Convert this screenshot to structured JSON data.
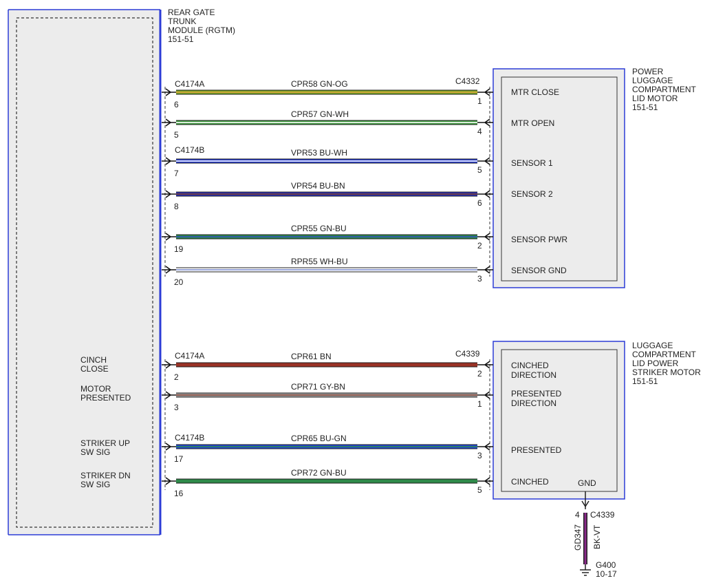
{
  "rgtm": {
    "title_lines": [
      "REAR GATE",
      "TRUNK",
      "MODULE (RGTM)",
      "151-51"
    ]
  },
  "motor1": {
    "title_lines": [
      "POWER",
      "LUGGAGE",
      "COMPARTMENT",
      "LID MOTOR",
      "151-51"
    ]
  },
  "motor2": {
    "title_lines": [
      "LUGGAGE",
      "COMPARTMENT",
      "LID POWER",
      "STRIKER MOTOR",
      "151-51"
    ]
  },
  "left_labels": [
    {
      "lines": [
        "CINCH",
        "CLOSE"
      ]
    },
    {
      "lines": [
        "MOTOR",
        "PRESENTED"
      ]
    },
    {
      "lines": [
        "STRIKER UP",
        "SW SIG"
      ]
    },
    {
      "lines": [
        "STRIKER DN",
        "SW SIG"
      ]
    }
  ],
  "connectors": {
    "left": [
      "C4174A",
      "C4174B",
      "C4174A",
      "C4174B"
    ],
    "right": [
      "C4332",
      "C4339"
    ]
  },
  "wires": [
    {
      "circuit": "CPR58",
      "color": "GN-OG",
      "left_pin": "6",
      "right_pin": "1",
      "pin_label": "MTR CLOSE",
      "c1": "#7aa628",
      "c2": "#e0a43a"
    },
    {
      "circuit": "CPR57",
      "color": "GN-WH",
      "left_pin": "5",
      "right_pin": "4",
      "pin_label": "MTR OPEN",
      "c1": "#3f9a3f",
      "c2": "#ffffff"
    },
    {
      "circuit": "VPR53",
      "color": "BU-WH",
      "left_pin": "7",
      "right_pin": "5",
      "pin_label": "SENSOR 1",
      "c1": "#2a3fd0",
      "c2": "#ffffff"
    },
    {
      "circuit": "VPR54",
      "color": "BU-BN",
      "left_pin": "8",
      "right_pin": "6",
      "pin_label": "SENSOR 2",
      "c1": "#2a2fb8",
      "c2": "#7a3d20"
    },
    {
      "circuit": "CPR55",
      "color": "GN-BU",
      "left_pin": "19",
      "right_pin": "2",
      "pin_label": "SENSOR PWR",
      "c1": "#2f8a4a",
      "c2": "#3050c0"
    },
    {
      "circuit": "RPR55",
      "color": "WH-BU",
      "left_pin": "20",
      "right_pin": "3",
      "pin_label": "SENSOR GND",
      "c1": "#ffffff",
      "c2": "#8090d0"
    },
    {
      "circuit": "CPR61",
      "color": "BN",
      "left_pin": "2",
      "right_pin": "2",
      "pin_label": "CINCHED\nDIRECTION",
      "c1": "#9a3326",
      "c2": "#9a3326"
    },
    {
      "circuit": "CPR71",
      "color": "GY-BN",
      "left_pin": "3",
      "right_pin": "1",
      "pin_label": "PRESENTED\nDIRECTION",
      "c1": "#a0a0a0",
      "c2": "#8a4a3a"
    },
    {
      "circuit": "CPR65",
      "color": "BU-GN",
      "left_pin": "17",
      "right_pin": "3",
      "pin_label": "PRESENTED",
      "c1": "#2346d8",
      "c2": "#2f8a4a"
    },
    {
      "circuit": "CPR72",
      "color": "GN-BU",
      "left_pin": "16",
      "right_pin": "5",
      "pin_label": "CINCHED",
      "c1": "#2f8a4a",
      "c2": "#2f8a4a"
    }
  ],
  "ground": {
    "gnd_label": "GND",
    "pin": "4",
    "connector": "C4339",
    "circuit": "GD347",
    "color": "BK-VT",
    "ground_id": "G400",
    "ground_page": "10-17",
    "c1": "#222222",
    "c2": "#8a2a8a"
  },
  "colors": {
    "frame": "#2b3bd6",
    "box_fill": "#ececec"
  }
}
